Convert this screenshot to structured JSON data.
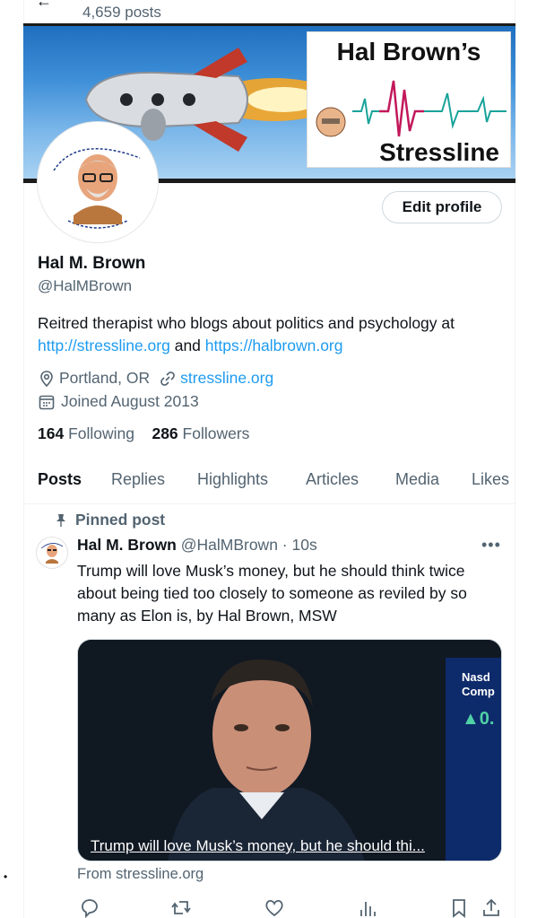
{
  "header": {
    "post_count": "4,659 posts"
  },
  "banner": {
    "title": "Hal Brown’s",
    "subtitle": "Stressline"
  },
  "profile": {
    "edit_label": "Edit profile",
    "name": "Hal M. Brown",
    "handle": "@HalMBrown",
    "bio_prefix": "Reitred therapist who blogs about politics and psychology at ",
    "bio_link1": "http://stressline.org",
    "bio_middle": " and ",
    "bio_link2": "https://halbrown.org",
    "location": "Portland, OR",
    "website": "stressline.org",
    "joined": "Joined August 2013",
    "following_count": "164",
    "following_label": "Following",
    "followers_count": "286",
    "followers_label": "Followers"
  },
  "tabs": [
    "Posts",
    "Replies",
    "Highlights",
    "Articles",
    "Media",
    "Likes"
  ],
  "tweet": {
    "pinned_label": "Pinned post",
    "author": "Hal M. Brown",
    "handle_time": "@HalMBrown · 10s",
    "text": "Trump will love Musk’s money, but he should think twice about being tied too closely to someone as reviled by so many as Elon is, by Hal Brown, MSW",
    "card_caption": "Trump will love Musk’s money, but he should thi...",
    "card_source": "From stressline.org"
  },
  "colors": {
    "accent": "#1d9bf0",
    "muted": "#536471",
    "text": "#0f1419"
  }
}
